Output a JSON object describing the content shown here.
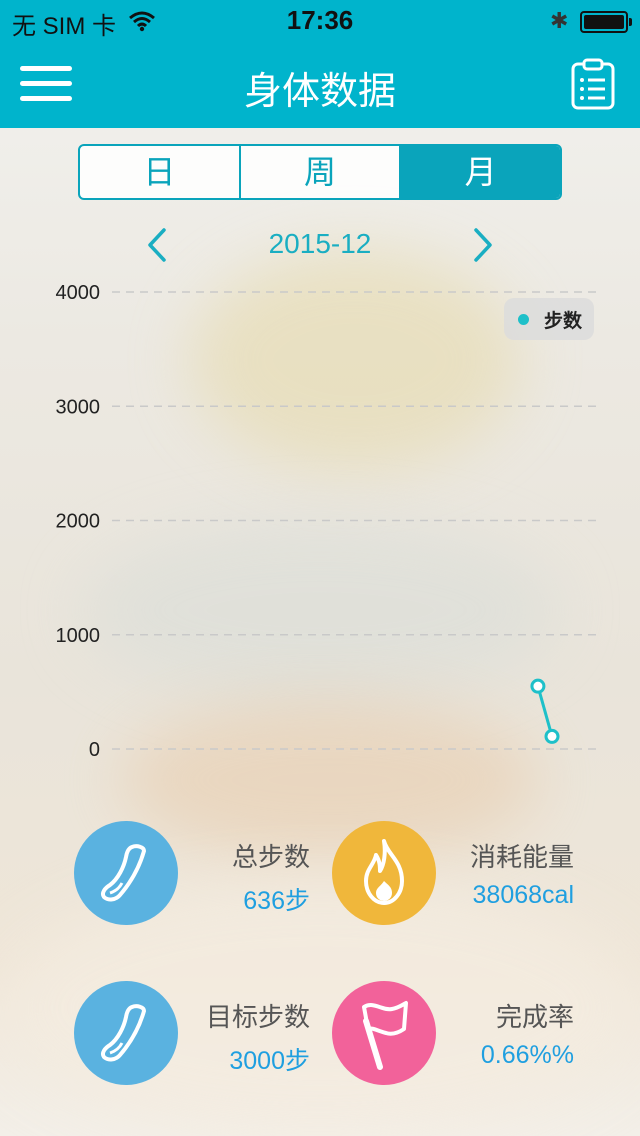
{
  "status_bar": {
    "carrier": "无 SIM 卡",
    "time": "17:36",
    "bluetooth_icon": "bluetooth-icon",
    "battery_icon": "battery-icon"
  },
  "nav": {
    "title": "身体数据",
    "menu_icon": "hamburger-menu-icon",
    "report_icon": "clipboard-icon"
  },
  "segments": [
    {
      "label": "日",
      "selected": false
    },
    {
      "label": "周",
      "selected": false
    },
    {
      "label": "月",
      "selected": true
    }
  ],
  "month_nav": {
    "prev_icon": "chevron-left-icon",
    "current": "2015-12",
    "next_icon": "chevron-right-icon"
  },
  "chart_data": {
    "type": "line",
    "legend": [
      {
        "name": "步数",
        "color": "#1ec0c9"
      }
    ],
    "legend_position": "top-right",
    "yticks": [
      "4000",
      "3000",
      "2000",
      "1000",
      "0"
    ],
    "ylim": [
      0,
      4000
    ],
    "grid": true,
    "series": [
      {
        "name": "步数",
        "color": "#1ec0c9",
        "points": [
          {
            "x": 30,
            "y": 550
          },
          {
            "x": 31,
            "y": 110
          }
        ]
      }
    ],
    "xlim": [
      1,
      31
    ]
  },
  "stats": [
    {
      "label": "总步数",
      "value": "636步",
      "icon": "shoe-icon",
      "color": "#5ab2e0"
    },
    {
      "label": "消耗能量",
      "value": "38068cal",
      "icon": "flame-icon",
      "color": "#f0b73b"
    },
    {
      "label": "目标步数",
      "value": "3000步",
      "icon": "shoe-icon",
      "color": "#5ab2e0"
    },
    {
      "label": "完成率",
      "value": "0.66%%",
      "icon": "flag-icon",
      "color": "#f2629a"
    }
  ],
  "colors": {
    "primary": "#00b4cc",
    "accent": "#0aa4bb",
    "value_blue": "#1f9fe0"
  }
}
